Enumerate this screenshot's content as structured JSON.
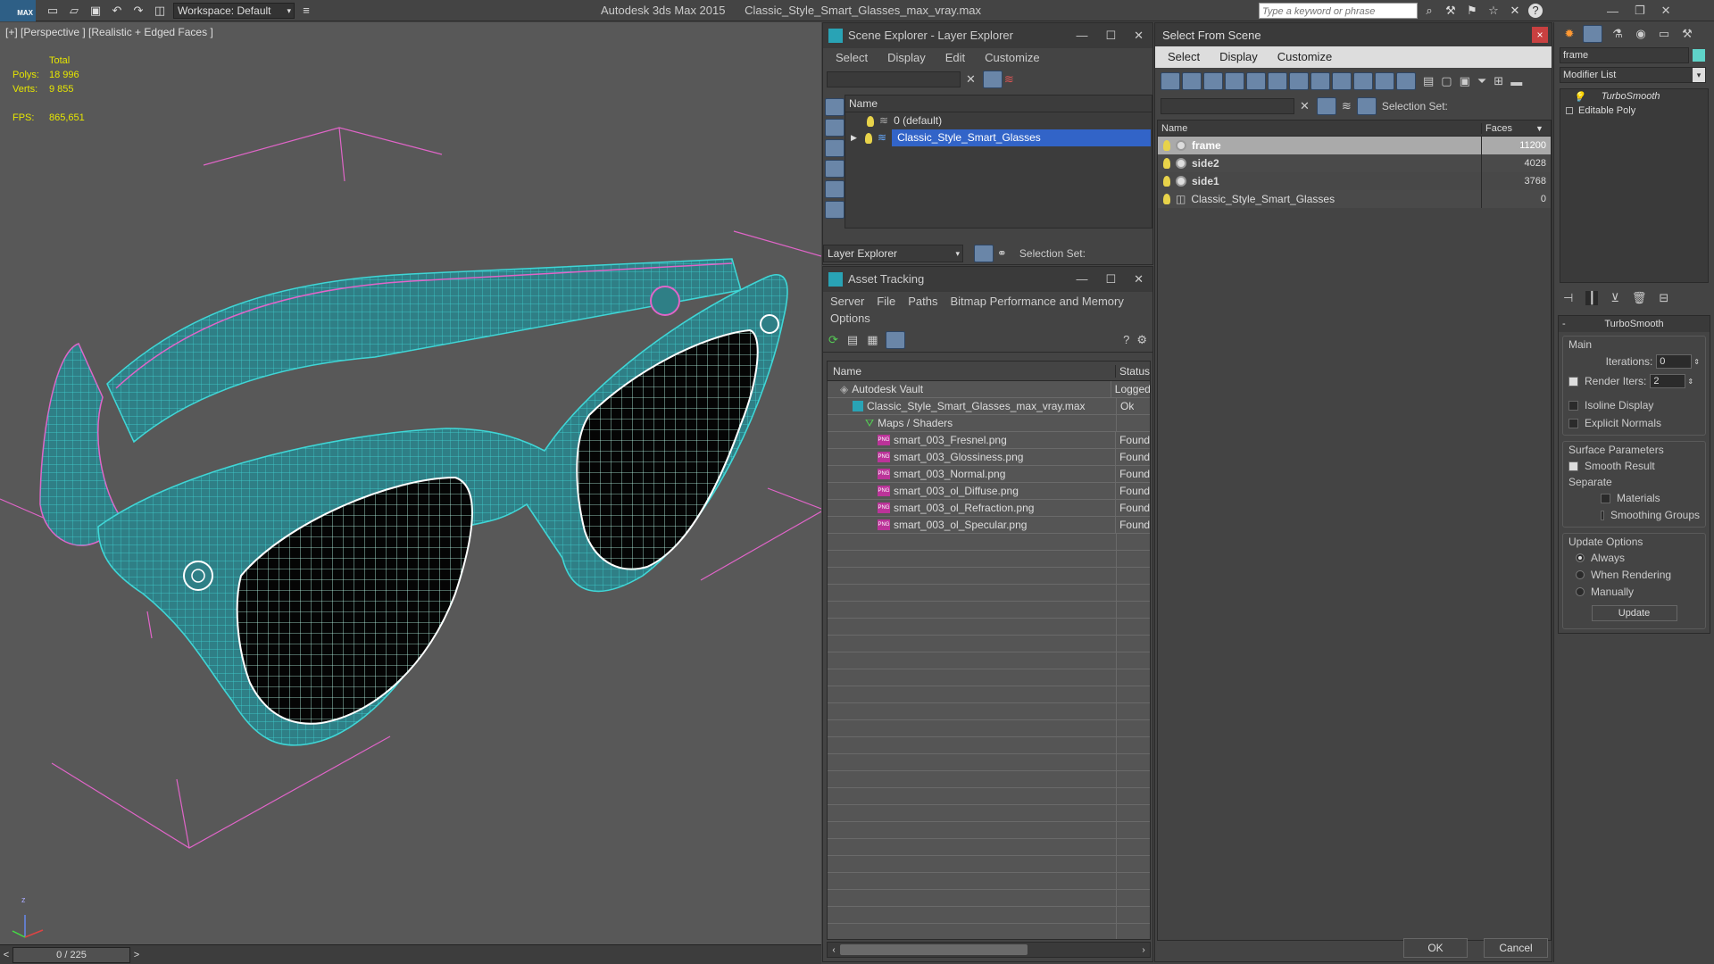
{
  "app": {
    "title": "Autodesk 3ds Max  2015",
    "file": "Classic_Style_Smart_Glasses_max_vray.max",
    "logo": "MAX",
    "workspace": "Workspace: Default",
    "search_placeholder": "Type a keyword or phrase"
  },
  "viewport": {
    "label": "[+] [Perspective ] [Realistic + Edged Faces ]",
    "stats": {
      "total_label": "Total",
      "polys_label": "Polys:",
      "polys": "18 996",
      "verts_label": "Verts:",
      "verts": "9 855",
      "fps_label": "FPS:",
      "fps": "865,651"
    },
    "axis_z": "z"
  },
  "timeline": {
    "frame": "0 / 225",
    "prev": "<",
    "next": ">"
  },
  "layer_explorer": {
    "title": "Scene Explorer - Layer Explorer",
    "menu": [
      "Select",
      "Display",
      "Edit",
      "Customize"
    ],
    "col_name": "Name",
    "rows": [
      "0 (default)",
      "Classic_Style_Smart_Glasses"
    ],
    "footer_combo": "Layer Explorer",
    "selection_set": "Selection Set:"
  },
  "asset_tracking": {
    "title": "Asset Tracking",
    "menu": [
      "Server",
      "File",
      "Paths",
      "Bitmap Performance and Memory"
    ],
    "menu2": "Options",
    "col_name": "Name",
    "col_status": "Status",
    "rows": [
      {
        "name": "Autodesk Vault",
        "status": "Logged",
        "indent": 0
      },
      {
        "name": "Classic_Style_Smart_Glasses_max_vray.max",
        "status": "Ok",
        "indent": 1
      },
      {
        "name": "Maps / Shaders",
        "status": "",
        "indent": 2
      },
      {
        "name": "smart_003_Fresnel.png",
        "status": "Found",
        "indent": 3
      },
      {
        "name": "smart_003_Glossiness.png",
        "status": "Found",
        "indent": 3
      },
      {
        "name": "smart_003_Normal.png",
        "status": "Found",
        "indent": 3
      },
      {
        "name": "smart_003_ol_Diffuse.png",
        "status": "Found",
        "indent": 3
      },
      {
        "name": "smart_003_ol_Refraction.png",
        "status": "Found",
        "indent": 3
      },
      {
        "name": "smart_003_ol_Specular.png",
        "status": "Found",
        "indent": 3
      }
    ]
  },
  "select_scene": {
    "title": "Select From Scene",
    "menu": [
      "Select",
      "Display",
      "Customize"
    ],
    "selection_set": "Selection Set:",
    "col_name": "Name",
    "col_faces": "Faces",
    "rows": [
      {
        "name": "frame",
        "faces": "11200",
        "selected": true
      },
      {
        "name": "side2",
        "faces": "4028",
        "selected": false
      },
      {
        "name": "side1",
        "faces": "3768",
        "selected": false
      },
      {
        "name": "Classic_Style_Smart_Glasses",
        "faces": "0",
        "selected": false
      }
    ],
    "ok": "OK",
    "cancel": "Cancel"
  },
  "command_panel": {
    "object_name": "frame",
    "modifier_list": "Modifier List",
    "stack": [
      "TurboSmooth",
      "Editable Poly"
    ],
    "rollout_title": "TurboSmooth",
    "main_label": "Main",
    "iterations_label": "Iterations:",
    "iterations": "0",
    "render_iters_label": "Render Iters:",
    "render_iters": "2",
    "isoline": "Isoline Display",
    "explicit_normals": "Explicit Normals",
    "surface_params": "Surface Parameters",
    "smooth_result": "Smooth Result",
    "separate": "Separate",
    "materials": "Materials",
    "smoothing_groups": "Smoothing Groups",
    "update_options": "Update Options",
    "always": "Always",
    "when_rendering": "When Rendering",
    "manually": "Manually",
    "update_btn": "Update"
  },
  "colors": {
    "wire": "#3fd6d6",
    "mesh": "#2f7f86",
    "pink": "#e065c8",
    "highlight": "#3264c8"
  }
}
